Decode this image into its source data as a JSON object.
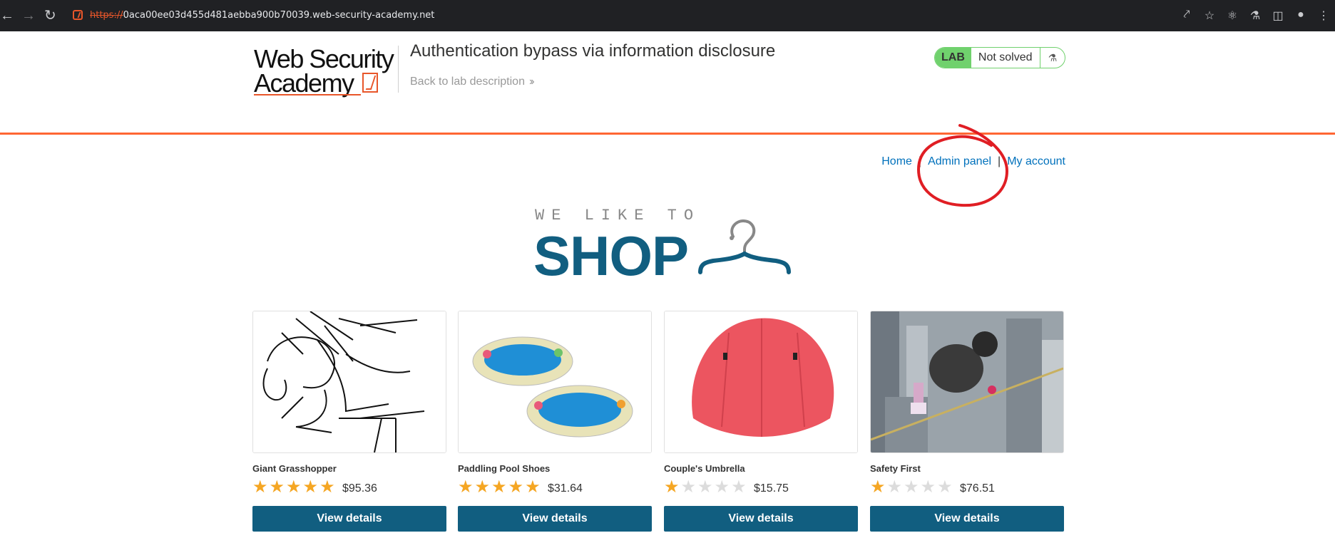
{
  "browser": {
    "url_scheme": "https://",
    "url_host": "0aca00ee03d455d481aebba900b70039.web-security-academy.net",
    "icons": [
      "back-icon",
      "forward-icon",
      "reload-icon",
      "share-icon",
      "star-icon",
      "extensions-icon",
      "lab-icon",
      "sidebar-icon",
      "profile-icon",
      "more-icon"
    ]
  },
  "header": {
    "logo_line1": "Web Security",
    "logo_line2": "Academy",
    "lab_title": "Authentication bypass via information disclosure",
    "back_link": "Back to lab description",
    "lab_badge": "LAB",
    "lab_status": "Not solved"
  },
  "nav": {
    "home": "Home",
    "admin_panel": "Admin panel",
    "my_account": "My account",
    "separator": "|"
  },
  "banner": {
    "tagline": "WE LIKE TO",
    "word": "SHOP"
  },
  "products": [
    {
      "name": "Giant Grasshopper",
      "price": "$95.36",
      "rating": 5,
      "button": "View details"
    },
    {
      "name": "Paddling Pool Shoes",
      "price": "$31.64",
      "rating": 5,
      "button": "View details"
    },
    {
      "name": "Couple's Umbrella",
      "price": "$15.75",
      "rating": 1,
      "button": "View details"
    },
    {
      "name": "Safety First",
      "price": "$76.51",
      "rating": 1,
      "button": "View details"
    }
  ],
  "colors": {
    "accent": "#ff6633",
    "brand_blue": "#115e80",
    "link": "#0071bc",
    "lab_green": "#70d16d",
    "star": "#f5a623",
    "annotation_red": "#e01e24"
  }
}
